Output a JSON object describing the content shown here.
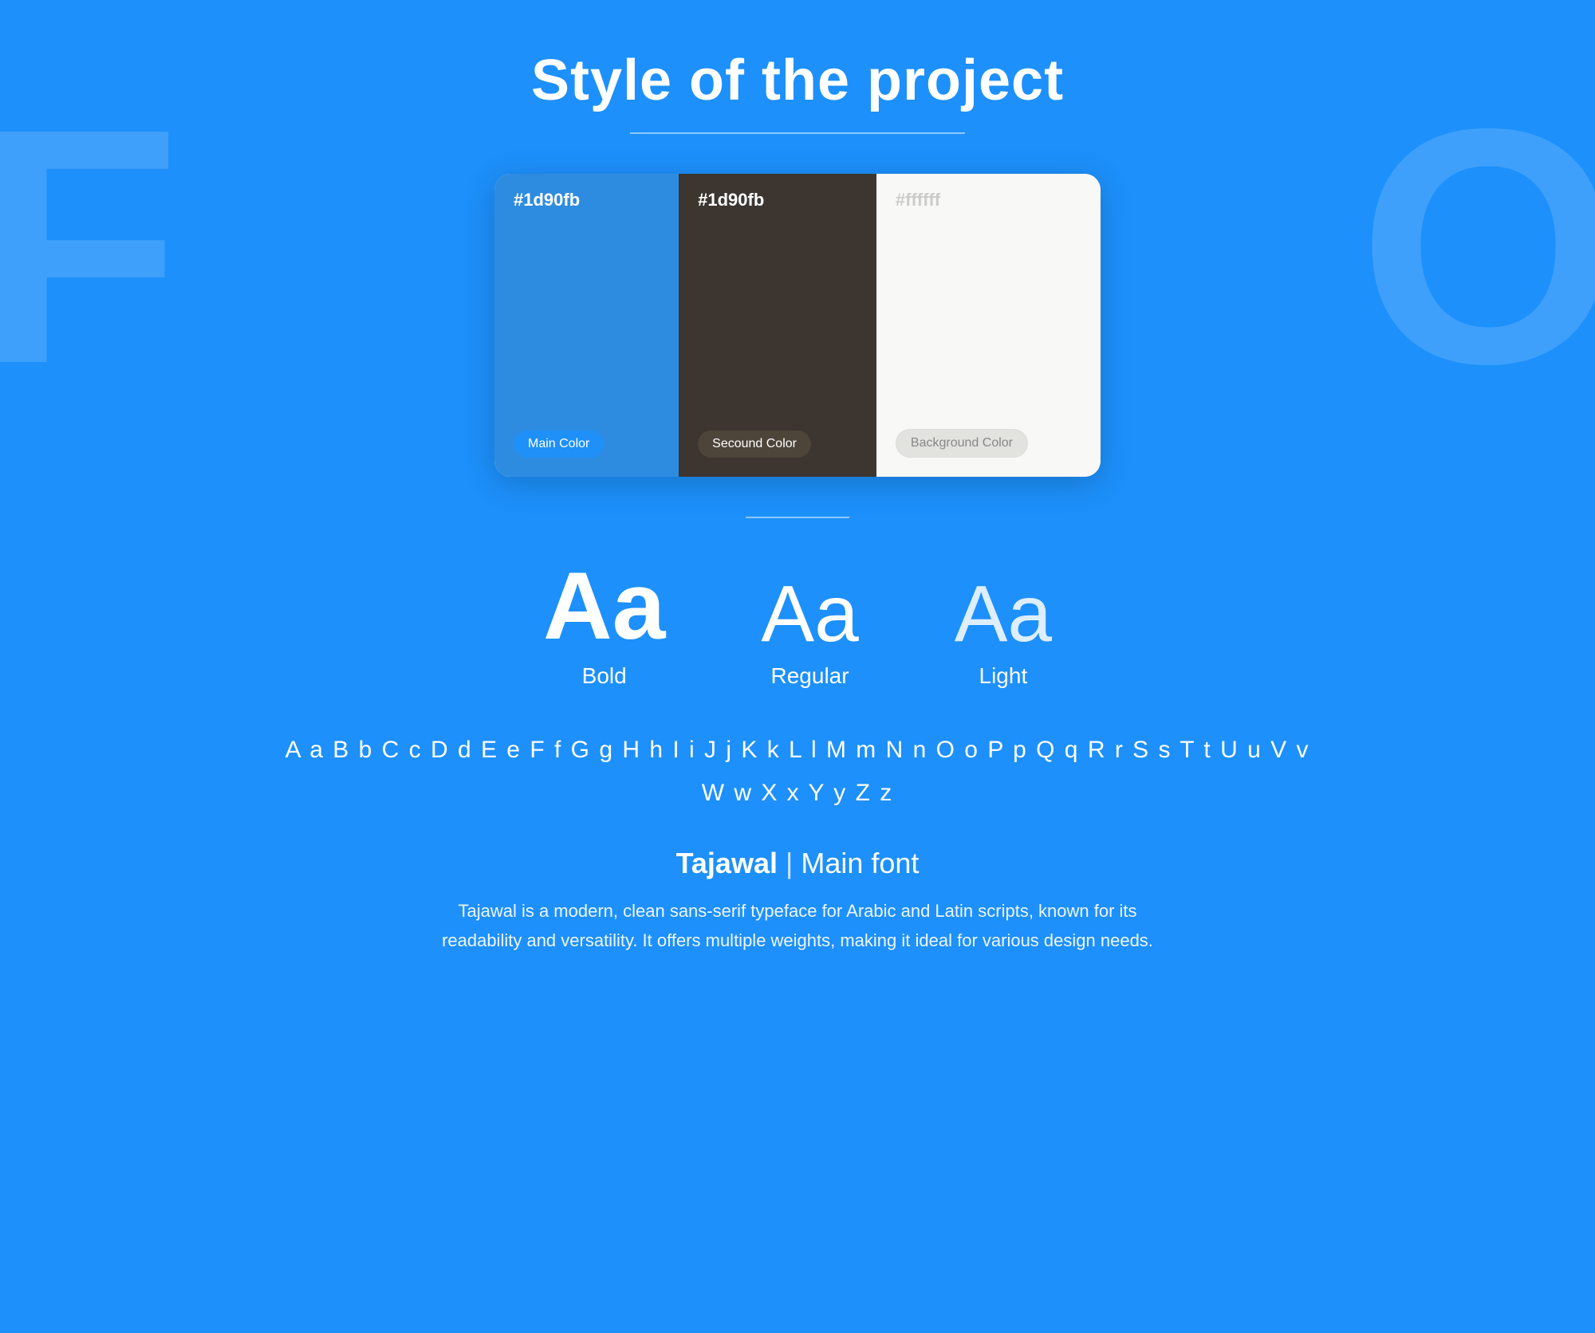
{
  "page": {
    "title": "Style of the project",
    "background_color": "#1d90fb"
  },
  "colors": [
    {
      "id": "main",
      "hex": "#1d90fb",
      "label": "Main Color",
      "swatch_bg": "#2e8ce0"
    },
    {
      "id": "second",
      "hex": "#1d90fb",
      "label": "Secound Color",
      "swatch_bg": "#3d3530"
    },
    {
      "id": "background",
      "hex": "#ffffff",
      "label": "Background Color",
      "swatch_bg": "#f8f8f6"
    }
  ],
  "typography": {
    "weights": [
      {
        "label": "Bold",
        "sample": "Aa",
        "weight": "bold"
      },
      {
        "label": "Regular",
        "sample": "Aa",
        "weight": "regular"
      },
      {
        "label": "Light",
        "sample": "Aa",
        "weight": "light"
      }
    ],
    "alphabet_line1": "A a B b C c D d E e F f G g H h I i J j K k L l M m N n O o P p Q q R r S s T t U u V v",
    "alphabet_line2": "W w X x Y y Z z",
    "font_name_bold": "Tajawal",
    "font_divider": "|",
    "font_subtitle": "Main font",
    "font_description": "Tajawal is a modern, clean sans-serif typeface for Arabic and Latin scripts, known for its readability and versatility. It offers multiple weights, making it ideal for various design needs."
  },
  "bg_decor": {
    "left": "F",
    "right": "O"
  }
}
